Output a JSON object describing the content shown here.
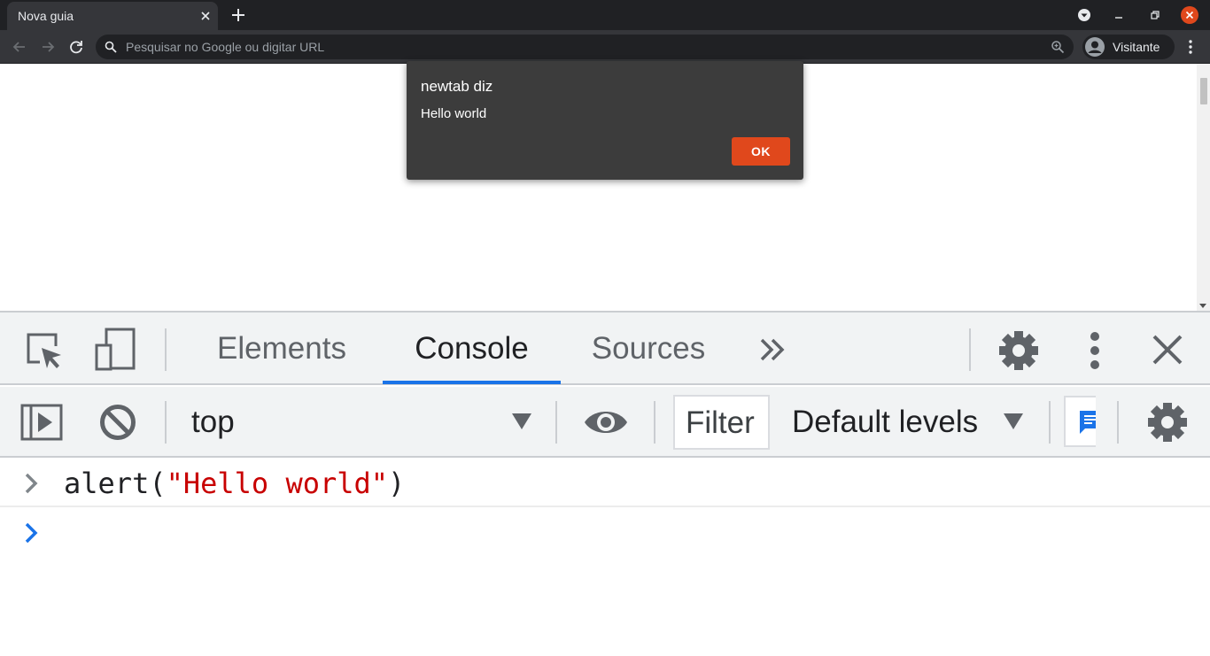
{
  "browser": {
    "tab": {
      "title": "Nova guia"
    },
    "omnibox": {
      "placeholder": "Pesquisar no Google ou digitar URL"
    },
    "profile": {
      "name": "Visitante"
    }
  },
  "dialog": {
    "title": "newtab diz",
    "message": "Hello world",
    "ok_label": "OK",
    "accent_color": "#e0481c"
  },
  "devtools": {
    "tabs": [
      {
        "label": "Elements",
        "active": false
      },
      {
        "label": "Console",
        "active": true
      },
      {
        "label": "Sources",
        "active": false
      }
    ],
    "more_tabs_icon": "double-chevron-right",
    "console_toolbar": {
      "context": "top",
      "filter_placeholder": "Filter",
      "levels": "Default levels"
    },
    "console": {
      "entries": [
        {
          "fn": "alert(",
          "arg": "\"Hello world\"",
          "close": ")"
        }
      ],
      "accent_color": "#1a73e8"
    }
  }
}
